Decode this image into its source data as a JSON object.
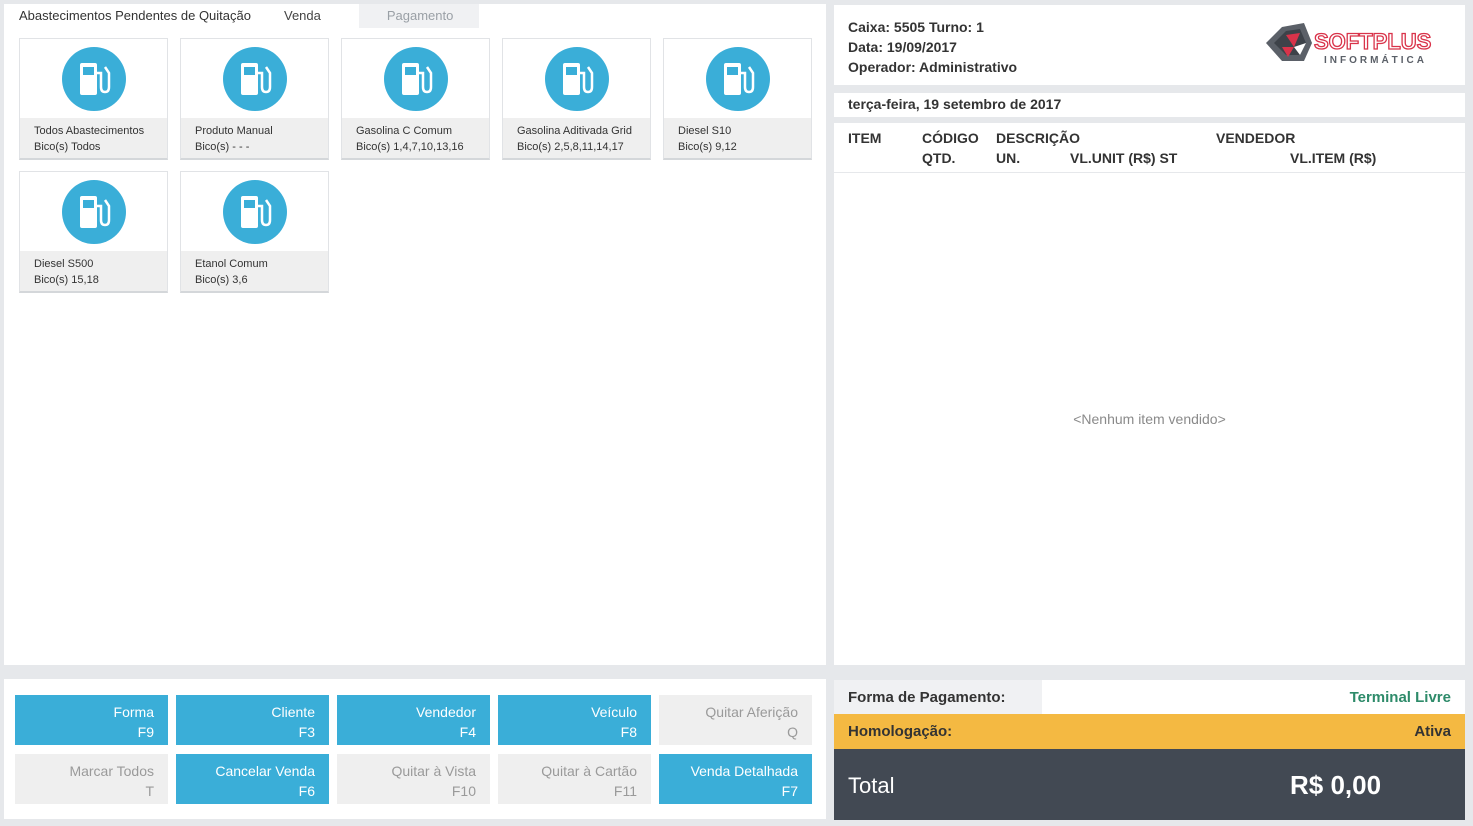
{
  "tabs": [
    {
      "label": "Abastecimentos Pendentes de Quitação"
    },
    {
      "label": "Venda"
    },
    {
      "label": "Pagamento"
    }
  ],
  "tiles": [
    {
      "name": "Todos Abastecimentos",
      "nozzles": "Bico(s) Todos"
    },
    {
      "name": "Produto Manual",
      "nozzles": "Bico(s) - - -"
    },
    {
      "name": "Gasolina C Comum",
      "nozzles": "Bico(s) 1,4,7,10,13,16"
    },
    {
      "name": "Gasolina Aditivada Grid",
      "nozzles": "Bico(s) 2,5,8,11,14,17"
    },
    {
      "name": "Diesel S10",
      "nozzles": "Bico(s) 9,12"
    },
    {
      "name": "Diesel S500",
      "nozzles": "Bico(s) 15,18"
    },
    {
      "name": "Etanol Comum",
      "nozzles": "Bico(s) 3,6"
    }
  ],
  "buttons": [
    {
      "label": "Forma",
      "key": "F9",
      "enabled": true
    },
    {
      "label": "Cliente",
      "key": "F3",
      "enabled": true
    },
    {
      "label": "Vendedor",
      "key": "F4",
      "enabled": true
    },
    {
      "label": "Veículo",
      "key": "F8",
      "enabled": true
    },
    {
      "label": "Quitar Aferição",
      "key": "Q",
      "enabled": false
    },
    {
      "label": "Marcar Todos",
      "key": "T",
      "enabled": false
    },
    {
      "label": "Cancelar Venda",
      "key": "F6",
      "enabled": true
    },
    {
      "label": "Quitar à Vista",
      "key": "F10",
      "enabled": false
    },
    {
      "label": "Quitar à Cartão",
      "key": "F11",
      "enabled": false
    },
    {
      "label": "Venda Detalhada",
      "key": "F7",
      "enabled": true
    }
  ],
  "header": {
    "caixa": "Caixa: 5505 Turno: 1",
    "data": "Data: 19/09/2017",
    "operador": "Operador: Administrativo",
    "logo_top": "SOFTPLUS",
    "logo_bottom": "INFORMÁTICA"
  },
  "date_line": "terça-feira, 19 setembro de 2017",
  "table": {
    "item": "ITEM",
    "codigo": "CÓDIGO",
    "descricao": "DESCRIÇÃO",
    "vendedor": "VENDEDOR",
    "qtd": "QTD.",
    "un": "UN.",
    "vl_unit": "VL.UNIT (R$) ST",
    "vl_item": "VL.ITEM (R$)",
    "empty": "<Nenhum item vendido>"
  },
  "payment": {
    "label": "Forma de Pagamento:",
    "value": "Terminal Livre"
  },
  "homologacao": {
    "label": "Homologação:",
    "value": "Ativa"
  },
  "total": {
    "label": "Total",
    "value": "R$ 0,00"
  },
  "colors": {
    "accent": "#3aaed8",
    "warning": "#f4b942",
    "total_bg": "#424953",
    "status_green": "#2e8b6a",
    "logo_red": "#d9334a"
  }
}
